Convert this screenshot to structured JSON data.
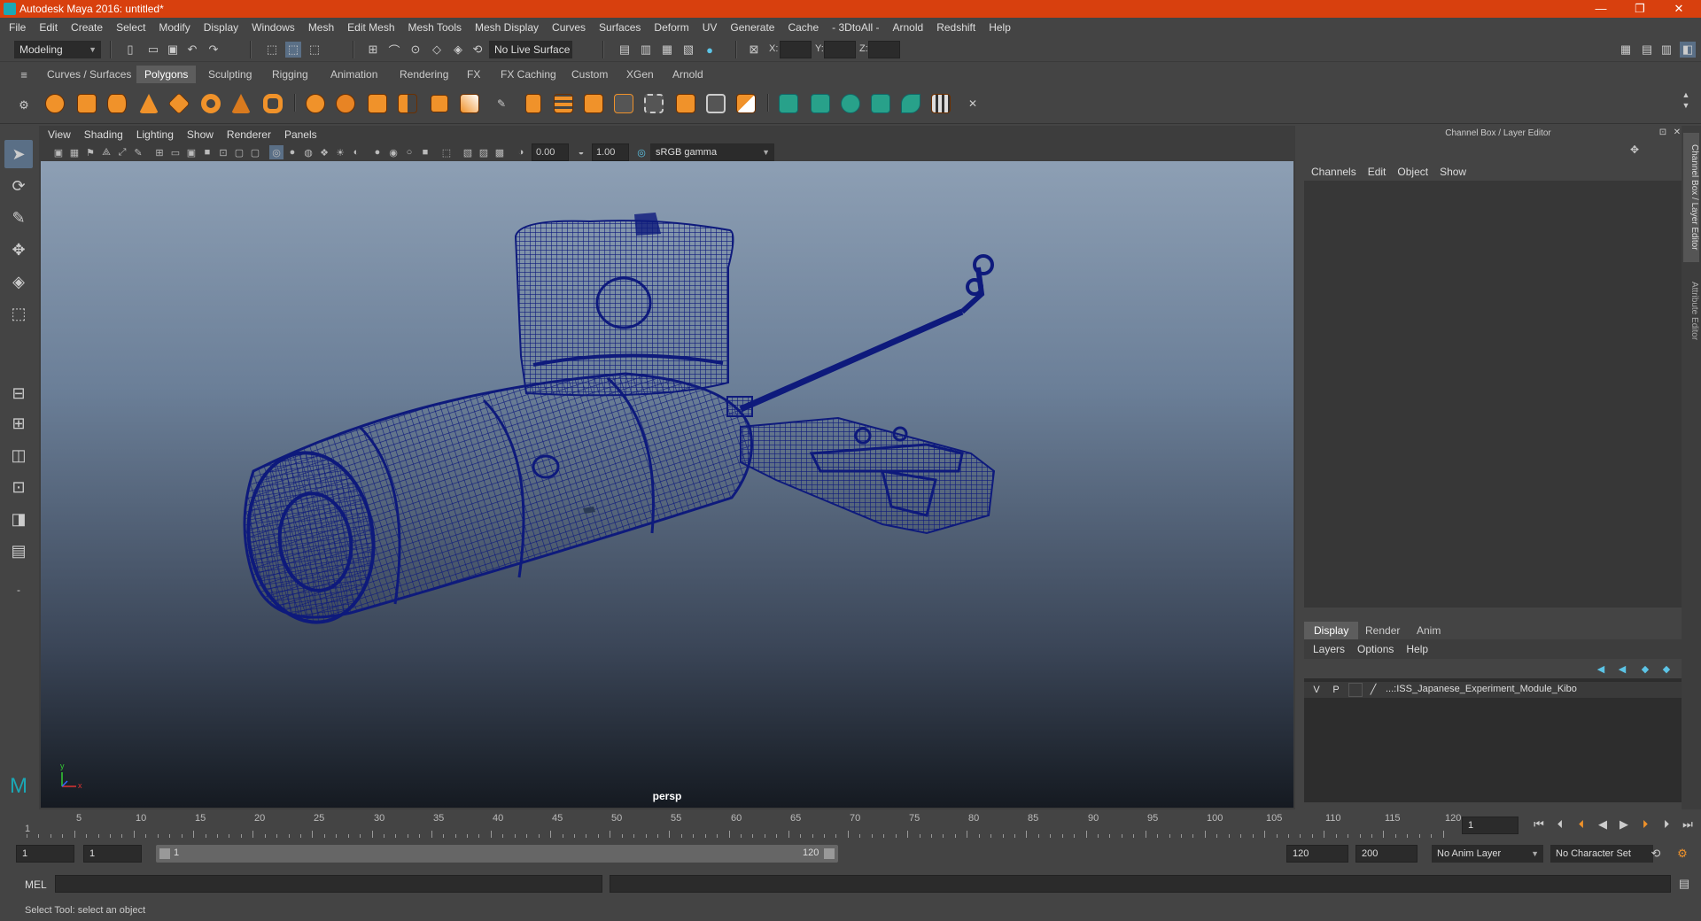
{
  "window": {
    "title": "Autodesk Maya 2016: untitled*",
    "controls": [
      "—",
      "❐",
      "✕"
    ]
  },
  "menubar": [
    "File",
    "Edit",
    "Create",
    "Select",
    "Modify",
    "Display",
    "Windows",
    "Mesh",
    "Edit Mesh",
    "Mesh Tools",
    "Mesh Display",
    "Curves",
    "Surfaces",
    "Deform",
    "UV",
    "Generate",
    "Cache",
    "- 3DtoAll -",
    "Arnold",
    "Redshift",
    "Help"
  ],
  "statusline": {
    "mode": "Modeling",
    "live_surface": "No Live Surface",
    "x_label": "X:",
    "y_label": "Y:",
    "z_label": "Z:"
  },
  "shelf_tabs": [
    "Curves / Surfaces",
    "Polygons",
    "Sculpting",
    "Rigging",
    "Animation",
    "Rendering",
    "FX",
    "FX Caching",
    "Custom",
    "XGen",
    "Arnold"
  ],
  "shelf_active": "Polygons",
  "viewport": {
    "menu": [
      "View",
      "Shading",
      "Lighting",
      "Show",
      "Renderer",
      "Panels"
    ],
    "exposure": "0.00",
    "gamma": "1.00",
    "color_space": "sRGB gamma",
    "camera": "persp",
    "axis_x": "x",
    "axis_y": "y"
  },
  "right_panel": {
    "header": "Channel Box / Layer Editor",
    "menu": [
      "Channels",
      "Edit",
      "Object",
      "Show"
    ],
    "layer_tabs": [
      "Display",
      "Render",
      "Anim"
    ],
    "layer_menu": [
      "Layers",
      "Options",
      "Help"
    ],
    "layer": {
      "v": "V",
      "p": "P",
      "name": "...:ISS_Japanese_Experiment_Module_Kibo"
    },
    "side_tabs": [
      "Channel Box / Layer Editor",
      "Attribute Editor"
    ]
  },
  "timeline": {
    "ticks": [
      "5",
      "10",
      "15",
      "20",
      "25",
      "30",
      "35",
      "40",
      "45",
      "50",
      "55",
      "60",
      "65",
      "70",
      "75",
      "80",
      "85",
      "90",
      "95",
      "100",
      "105",
      "110",
      "115",
      "120"
    ],
    "start_label": "1",
    "current_frame": "1"
  },
  "range": {
    "start": "1",
    "playback_start": "1",
    "slider_start": "1",
    "slider_end": "120",
    "playback_end": "120",
    "end": "200",
    "anim_layer": "No Anim Layer",
    "character_set": "No Character Set"
  },
  "command": {
    "label": "MEL"
  },
  "help_text": "Select Tool: select an object",
  "colors": {
    "titlebar": "#d8400e",
    "wireframe": "#0e1a7c",
    "shelf_orange": "#f0922a",
    "shelf_teal": "#28a18a"
  }
}
